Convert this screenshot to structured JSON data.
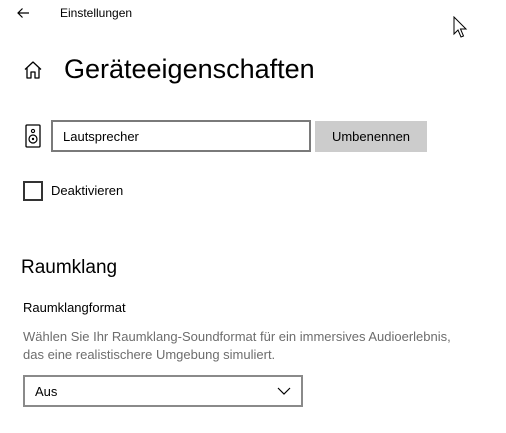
{
  "window": {
    "title": "Einstellungen"
  },
  "page": {
    "title": "Geräteeigenschaften"
  },
  "device": {
    "name_value": "Lautsprecher",
    "rename_label": "Umbenennen",
    "disable_label": "Deaktivieren",
    "disable_checked": false
  },
  "surround": {
    "heading": "Raumklang",
    "format_label": "Raumklangformat",
    "description": "Wählen Sie Ihr Raumklang-Soundformat für ein immersives Audioerlebnis, das eine realistischere Umgebung simuliert.",
    "format_selected": "Aus"
  },
  "icons": {
    "back": "back-arrow-icon",
    "home": "home-icon",
    "speaker": "speaker-icon",
    "chevron": "chevron-down-icon",
    "cursor": "mouse-cursor-icon"
  },
  "colors": {
    "background": "#ffffff",
    "button_bg": "#cccccc",
    "input_border": "#7a7a7a",
    "description_text": "#6d6d6d"
  }
}
